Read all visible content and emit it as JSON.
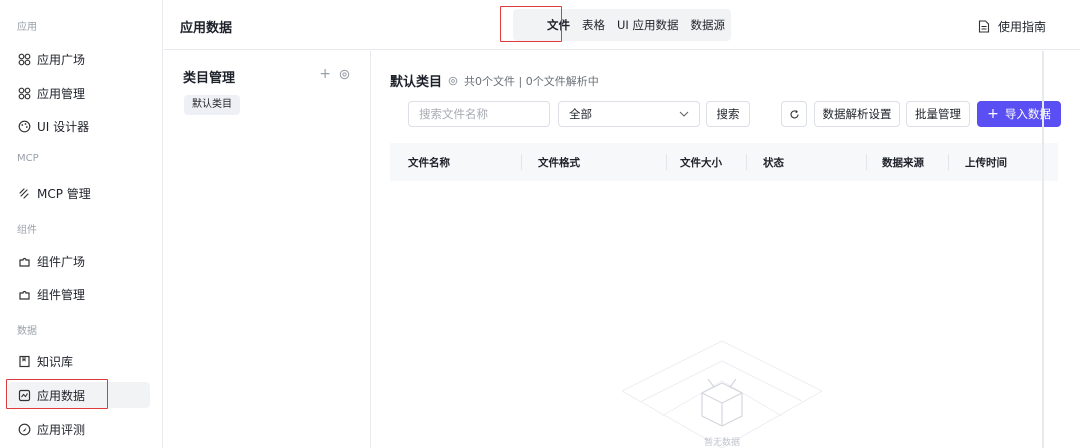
{
  "sidebar": {
    "sections": [
      {
        "title": "应用"
      },
      {
        "title": "MCP"
      },
      {
        "title": "组件"
      },
      {
        "title": "数据"
      }
    ],
    "items": [
      {
        "label": "应用广场",
        "icon": "grid-icon"
      },
      {
        "label": "应用管理",
        "icon": "grid-icon"
      },
      {
        "label": "UI 设计器",
        "icon": "palette-icon"
      },
      {
        "label": "MCP 管理",
        "icon": "mcp-icon"
      },
      {
        "label": "组件广场",
        "icon": "component-icon"
      },
      {
        "label": "组件管理",
        "icon": "component-icon"
      },
      {
        "label": "知识库",
        "icon": "book-icon"
      },
      {
        "label": "应用数据",
        "icon": "chart-icon",
        "active": true
      },
      {
        "label": "应用评测",
        "icon": "eval-icon"
      }
    ]
  },
  "header": {
    "title": "应用数据",
    "tabs": [
      "文件",
      "表格",
      "UI 应用数据",
      "数据源"
    ],
    "guide_label": "使用指南"
  },
  "category": {
    "title": "类目管理",
    "chip": "默认类目"
  },
  "main": {
    "title": "默认类目",
    "stats": "共0个文件 | 0个文件解析中",
    "search_placeholder": "搜索文件名称",
    "select_value": "全部",
    "search_btn": "搜索",
    "parse_settings_btn": "数据解析设置",
    "batch_btn": "批量管理",
    "import_btn": "导入数据",
    "columns": [
      "文件名称",
      "文件格式",
      "文件大小",
      "状态",
      "数据来源",
      "上传时间"
    ],
    "empty_text": "暂无数据"
  },
  "colors": {
    "accent": "#5a4ff2",
    "highlight": "#e03a3a"
  }
}
